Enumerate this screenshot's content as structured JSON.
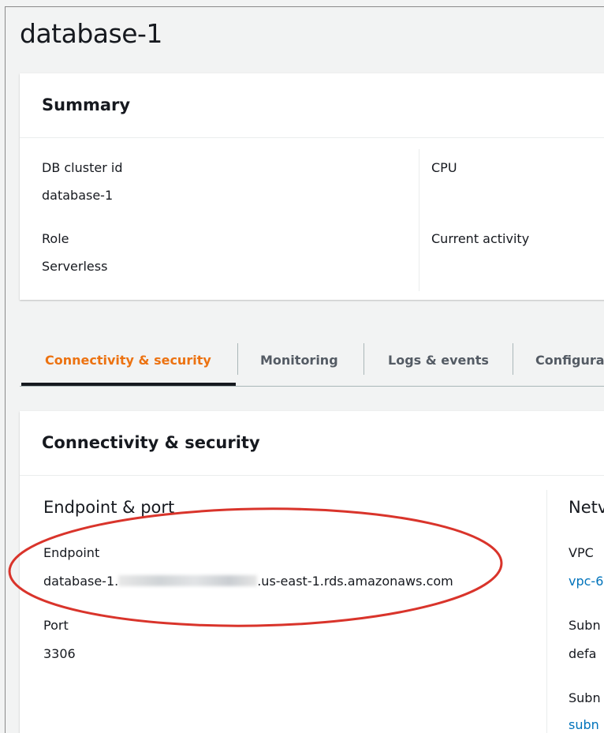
{
  "page": {
    "title": "database-1"
  },
  "summary": {
    "header": "Summary",
    "fields": {
      "cluster_id_label": "DB cluster id",
      "cluster_id_value": "database-1",
      "role_label": "Role",
      "role_value": "Serverless",
      "cpu_label": "CPU",
      "current_activity_label": "Current activity"
    }
  },
  "tabs": [
    {
      "label": "Connectivity & security",
      "active": true
    },
    {
      "label": "Monitoring",
      "active": false
    },
    {
      "label": "Logs & events",
      "active": false
    },
    {
      "label": "Configura",
      "active": false
    }
  ],
  "connectivity": {
    "header": "Connectivity & security",
    "endpoint_section": {
      "title": "Endpoint & port",
      "endpoint_label": "Endpoint",
      "endpoint_prefix": "database-1.",
      "endpoint_suffix": ".us-east-1.rds.amazonaws.com",
      "port_label": "Port",
      "port_value": "3306"
    },
    "network_section": {
      "title": "Netv",
      "vpc_label": "VPC",
      "vpc_value": "vpc-6",
      "subnet_group_label": "Subn",
      "subnet_group_value": "defa",
      "subnets_label": "Subn",
      "subnets_value": "subn"
    }
  },
  "colors": {
    "active_tab": "#ec7211",
    "link": "#0073bb",
    "highlight_oval": "#d9342b"
  }
}
